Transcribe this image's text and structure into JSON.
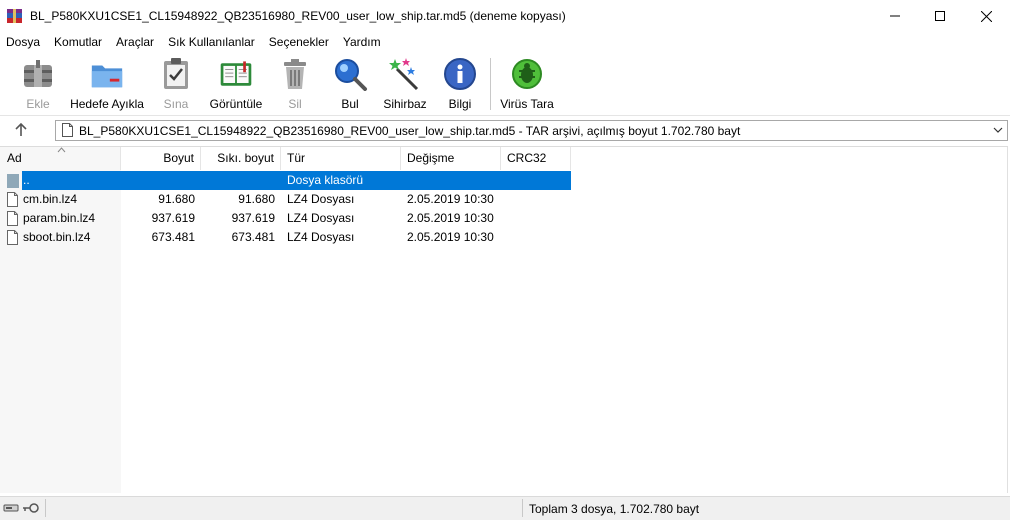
{
  "window": {
    "title": "BL_P580KXU1CSE1_CL15948922_QB23516980_REV00_user_low_ship.tar.md5 (deneme kopyası)"
  },
  "menu": [
    "Dosya",
    "Komutlar",
    "Araçlar",
    "Sık Kullanılanlar",
    "Seçenekler",
    "Yardım"
  ],
  "toolbar": {
    "add": "Ekle",
    "extract": "Hedefe Ayıkla",
    "test": "Sına",
    "view": "Görüntüle",
    "delete": "Sil",
    "find": "Bul",
    "wizard": "Sihirbaz",
    "info": "Bilgi",
    "virus": "Virüs Tara"
  },
  "address": {
    "text": "BL_P580KXU1CSE1_CL15948922_QB23516980_REV00_user_low_ship.tar.md5 - TAR arşivi, açılmış boyut 1.702.780 bayt"
  },
  "columns": {
    "name": "Ad",
    "size": "Boyut",
    "packed": "Sıkı. boyut",
    "type": "Tür",
    "modified": "Değişme",
    "crc": "CRC32"
  },
  "rows": [
    {
      "name": "..",
      "size": "",
      "packed": "",
      "type": "Dosya klasörü",
      "modified": ""
    },
    {
      "name": "cm.bin.lz4",
      "size": "91.680",
      "packed": "91.680",
      "type": "LZ4 Dosyası",
      "modified": "2.05.2019 10:30"
    },
    {
      "name": "param.bin.lz4",
      "size": "937.619",
      "packed": "937.619",
      "type": "LZ4 Dosyası",
      "modified": "2.05.2019 10:30"
    },
    {
      "name": "sboot.bin.lz4",
      "size": "673.481",
      "packed": "673.481",
      "type": "LZ4 Dosyası",
      "modified": "2.05.2019 10:30"
    }
  ],
  "status": {
    "summary": "Toplam 3 dosya, 1.702.780 bayt"
  },
  "colors": {
    "selection": "#0078d7"
  }
}
